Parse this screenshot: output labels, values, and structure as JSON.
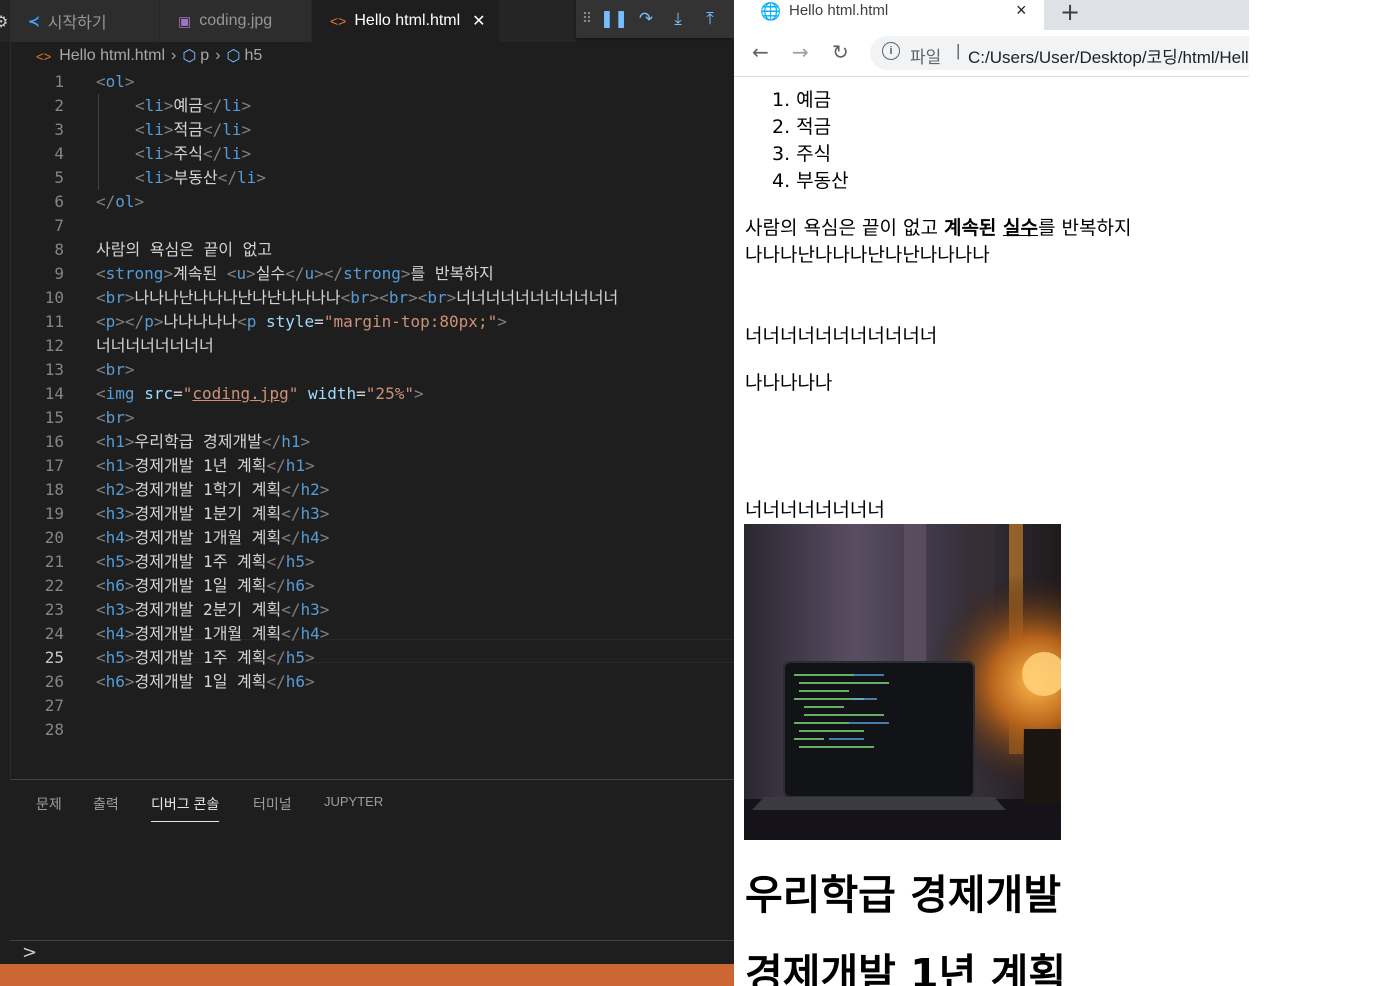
{
  "vscode": {
    "tabs": [
      {
        "label": "시작하기",
        "icon": "vscode-logo-icon"
      },
      {
        "label": "coding.jpg",
        "icon": "image-file-icon"
      },
      {
        "label": "Hello html.html",
        "icon": "html-file-icon",
        "active": true
      }
    ],
    "debug_toolbar": [
      "drag-handle-icon",
      "pause-icon",
      "step-over-icon",
      "step-into-icon",
      "step-out-icon"
    ],
    "breadcrumb": {
      "file": "Hello html.html",
      "items": [
        "p",
        "h5"
      ]
    },
    "line_numbers": [
      "1",
      "2",
      "3",
      "4",
      "5",
      "6",
      "7",
      "8",
      "9",
      "10",
      "11",
      "12",
      "13",
      "14",
      "15",
      "16",
      "17",
      "18",
      "19",
      "20",
      "21",
      "22",
      "23",
      "24",
      "25",
      "26",
      "27",
      "28"
    ],
    "current_line": "25",
    "code": {
      "l1": {
        "o": "<",
        "tag": "ol",
        "c": ">"
      },
      "l2": {
        "o": "<",
        "tag": "li",
        "m": ">",
        "text": "예금",
        "co": "</",
        "ctag": "li",
        "c": ">"
      },
      "l3": {
        "o": "<",
        "tag": "li",
        "m": ">",
        "text": "적금",
        "co": "</",
        "ctag": "li",
        "c": ">"
      },
      "l4": {
        "o": "<",
        "tag": "li",
        "m": ">",
        "text": "주식",
        "co": "</",
        "ctag": "li",
        "c": ">"
      },
      "l5": {
        "o": "<",
        "tag": "li",
        "m": ">",
        "text": "부동산",
        "co": "</",
        "ctag": "li",
        "c": ">"
      },
      "l6": {
        "o": "</",
        "tag": "ol",
        "c": ">"
      },
      "l8": "사람의 욕심은 끝이 없고",
      "l9": {
        "o1": "<",
        "t1": "strong",
        "c1": ">",
        "txt1": "계속된 ",
        "o2": "<",
        "t2": "u",
        "c2": ">",
        "txt2": "실수",
        "o3": "</",
        "t3": "u",
        "c3": "></",
        "t4": "strong",
        "c4": ">",
        "txt3": "를 반복하지"
      },
      "l10": {
        "o1": "<",
        "t1": "br",
        "c1": ">",
        "txt1": "나나나난나나나난나난나나나나",
        "o2": "<",
        "t2": "br",
        "c2": "><",
        "t3": "br",
        "c3": "><",
        "t4": "br",
        "c4": ">",
        "txt2": "너너너너너너너너너너너"
      },
      "l11": {
        "o1": "<",
        "t1": "p",
        "c1": "></",
        "t2": "p",
        "c2": ">",
        "txt1": "나나나나나",
        "o3": "<",
        "t3": "p",
        "attr": "style",
        "eq": "=",
        "val": "\"margin-top:80px;\"",
        "c3": ">"
      },
      "l12": "너너너너너너너너",
      "l13": {
        "o": "<",
        "tag": "br",
        "c": ">"
      },
      "l14": {
        "o": "<",
        "tag": "img",
        "a1": "src",
        "eq1": "=",
        "q1": "\"",
        "v1": "coding.jpg",
        "q2": "\"",
        "a2": "width",
        "eq2": "=",
        "v2": "\"25%\"",
        "c": ">"
      },
      "l15": {
        "o": "<",
        "tag": "br",
        "c": ">"
      },
      "l16": {
        "tag": "h1",
        "text": "우리학급 경제개발"
      },
      "l17": {
        "tag": "h1",
        "text": "경제개발 1년 계획"
      },
      "l18": {
        "tag": "h2",
        "text": "경제개발 1학기 계획"
      },
      "l19": {
        "tag": "h3",
        "text": "경제개발 1분기 계획"
      },
      "l20": {
        "tag": "h4",
        "text": "경제개발 1개월 계획"
      },
      "l21": {
        "tag": "h5",
        "text": "경제개발 1주 계획"
      },
      "l22": {
        "tag": "h6",
        "text": "경제개발 1일 계획"
      },
      "l23": {
        "tag": "h3",
        "text": "경제개발 2분기 계획"
      },
      "l24": {
        "tag": "h4",
        "text": "경제개발 1개월 계획"
      },
      "l25": {
        "tag": "h5",
        "text": "경제개발 1주 계획"
      },
      "l26": {
        "tag": "h6",
        "text": "경제개발 1일 계획"
      }
    },
    "panel_tabs": [
      "문제",
      "출력",
      "디버그 콘솔",
      "터미널",
      "JUPYTER"
    ],
    "active_panel_tab": "디버그 콘솔",
    "prompt": ">",
    "status_bar_color": "#cc6633"
  },
  "chrome": {
    "tab_title": "Hello html.html",
    "close_icon": "×",
    "new_tab_icon": "+",
    "address": {
      "scheme_label": "파일",
      "separator": "|",
      "url": "C:/Users/User/Desktop/코딩/html/Hello html.html"
    },
    "page": {
      "list": [
        "1. 예금",
        "2. 적금",
        "3. 주식",
        "4. 부동산"
      ],
      "sentence": {
        "plain": "사람의 욕심은 끝이 없고 ",
        "bold1": "계속된 ",
        "bold_underlined": "실수",
        "rest": "를 반복하지"
      },
      "line2": "나나나난나나나난나난나나나나",
      "line3": "너너너너너너너너너너너",
      "line4": "나나나나나",
      "line5": "너너너너너너너너",
      "image_alt": "coding.jpg",
      "h1a": "우리학급 경제개발",
      "h1b": "경제개발 1년 계획"
    }
  }
}
